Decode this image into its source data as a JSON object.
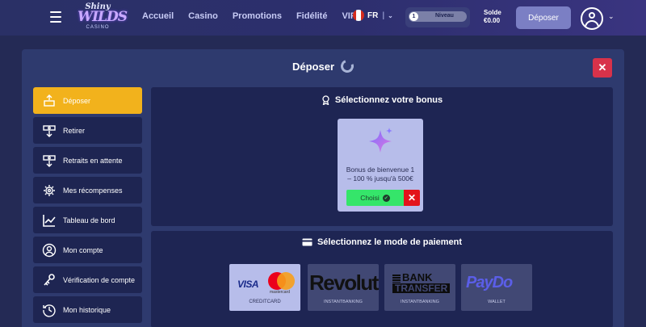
{
  "header": {
    "logo": {
      "line1": "Shiny",
      "line2": "WILDS",
      "line3": "CASINO"
    },
    "nav": [
      "Accueil",
      "Casino",
      "Promotions",
      "Fidélité",
      "VIP"
    ],
    "language": "FR",
    "level": {
      "number": "1",
      "label": "Niveau"
    },
    "balance": {
      "label": "Solde",
      "value": "€0.00"
    },
    "deposit_button": "Déposer"
  },
  "modal": {
    "title": "Déposer",
    "close": "✕",
    "sidebar": [
      {
        "label": "Déposer",
        "icon": "deposit-icon",
        "active": true
      },
      {
        "label": "Retirer",
        "icon": "withdraw-icon",
        "active": false
      },
      {
        "label": "Retraits en attente",
        "icon": "pending-withdraw-icon",
        "active": false
      },
      {
        "label": "Mes récompenses",
        "icon": "rewards-icon",
        "active": false
      },
      {
        "label": "Tableau de bord",
        "icon": "dashboard-chart-icon",
        "active": false
      },
      {
        "label": "Mon compte",
        "icon": "user-icon",
        "active": false
      },
      {
        "label": "Vérification de compte",
        "icon": "key-icon",
        "active": false
      },
      {
        "label": "Mon historique",
        "icon": "history-icon",
        "active": false
      }
    ],
    "bonus": {
      "title": "Sélectionnez votre bonus",
      "card_line1": "Bonus de bienvenue 1",
      "card_line2": "– 100 % jusqu'à 500€",
      "choose_label": "Choisi",
      "remove": "✕"
    },
    "payment": {
      "title": "Sélectionnez le mode de paiement",
      "methods": [
        {
          "name": "VISA mastercard",
          "caption": "CREDITCARD",
          "selected": true
        },
        {
          "name": "Revolut",
          "caption": "INSTANTBANKING",
          "selected": false
        },
        {
          "name": "BANK TRANSFER",
          "caption": "INSTANTBANKING",
          "selected": false
        },
        {
          "name": "PayDo",
          "caption": "WALLET",
          "selected": false
        }
      ],
      "visa_text": "VISA",
      "mastercard_text": "mastercard",
      "revolut_text": "Revolut",
      "bank_line1": "BANK",
      "bank_line2": "TRANSFER",
      "paydo_text": "PayDo"
    }
  },
  "colors": {
    "accent": "#f2b21c",
    "close": "#d8324a",
    "choose": "#35e56a",
    "remove": "#e3131b"
  }
}
